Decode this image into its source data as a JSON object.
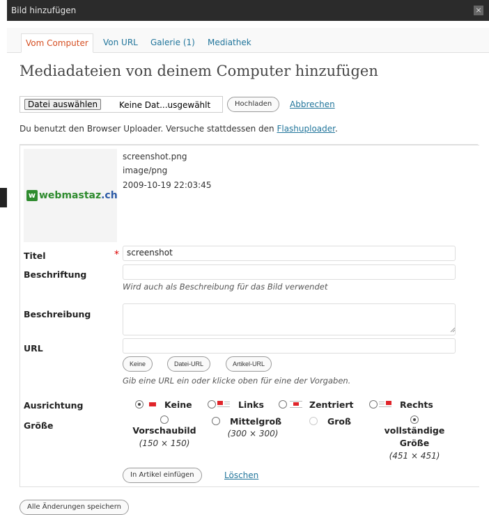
{
  "window": {
    "title": "Bild hinzufügen",
    "close_glyph": "×"
  },
  "tabs": [
    {
      "label": "Vom Computer",
      "active": true
    },
    {
      "label": "Von URL",
      "active": false
    },
    {
      "label": "Galerie (1)",
      "active": false
    },
    {
      "label": "Mediathek",
      "active": false
    }
  ],
  "heading": "Mediadateien von deinem Computer hinzufügen",
  "upload": {
    "choose_label": "Datei auswählen",
    "file_status": "Keine Dat...usgewählt",
    "upload_label": "Hochladen",
    "cancel_label": "Abbrechen"
  },
  "note": {
    "text": "Du benutzt den Browser Uploader. Versuche stattdessen den ",
    "link": "Flashuploader",
    "suffix": "."
  },
  "item": {
    "thumb_logo_mark": "w",
    "thumb_logo_a": "webmastaz",
    "thumb_logo_b": ".ch",
    "filename": "screenshot.png",
    "mimetype": "image/png",
    "date": "2009-10-19 22:03:45"
  },
  "form": {
    "title_label": "Titel",
    "title_required": "*",
    "title_value": "screenshot",
    "caption_label": "Beschriftung",
    "caption_value": "",
    "caption_hint": "Wird auch als Beschreibung für das Bild verwendet",
    "description_label": "Beschreibung",
    "description_value": "",
    "url_label": "URL",
    "url_value": "",
    "url_buttons": [
      "Keine",
      "Datei-URL",
      "Artikel-URL"
    ],
    "url_hint": "Gib eine URL ein oder klicke oben für eine der Vorgaben.",
    "align_label": "Ausrichtung",
    "align_options": [
      {
        "label": "Keine",
        "checked": true
      },
      {
        "label": "Links",
        "checked": false
      },
      {
        "label": "Zentriert",
        "checked": false
      },
      {
        "label": "Rechts",
        "checked": false
      }
    ],
    "size_label": "Größe",
    "size_options": [
      {
        "name": "Vorschaubild",
        "dim": "(150 × 150)",
        "checked": false,
        "disabled": false
      },
      {
        "name": "Mittelgroß",
        "dim": "(300 × 300)",
        "checked": false,
        "disabled": false
      },
      {
        "name": "Groß",
        "dim": "",
        "checked": false,
        "disabled": true
      },
      {
        "name": "vollständige Größe",
        "dim": "(451 × 451)",
        "checked": true,
        "disabled": false
      }
    ],
    "insert_label": "In Artikel einfügen",
    "delete_label": "Löschen"
  },
  "save_all_label": "Alle Änderungen speichern",
  "colors": {
    "accent_link": "#21759b",
    "active_tab": "#d54e21",
    "titlebar": "#2b2b2b",
    "align_icon": "#e0242a"
  }
}
